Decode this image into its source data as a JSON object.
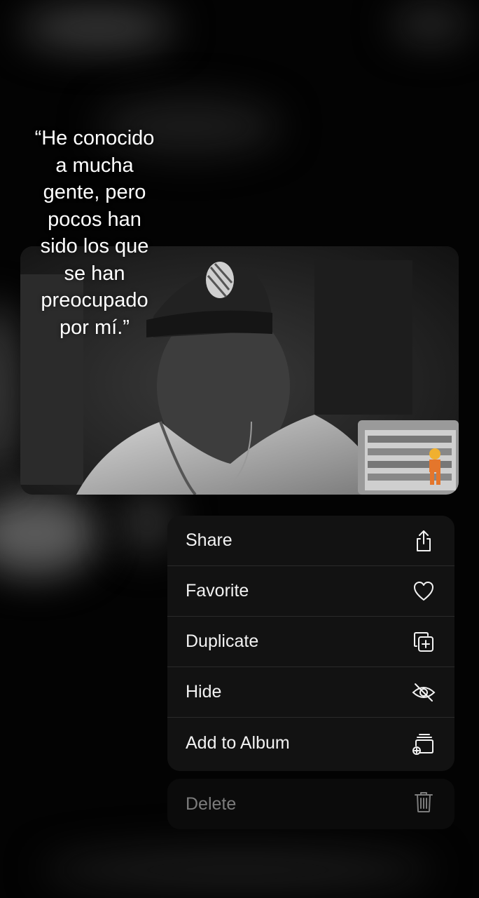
{
  "overlay": {
    "quote_text": "“He conocido a mucha gente, pero pocos han sido los que se han preocupado por mí.”"
  },
  "context_menu": {
    "items": [
      {
        "label": "Share",
        "icon": "share-icon"
      },
      {
        "label": "Favorite",
        "icon": "heart-icon"
      },
      {
        "label": "Duplicate",
        "icon": "duplicate-icon"
      },
      {
        "label": "Hide",
        "icon": "eye-slash-icon"
      },
      {
        "label": "Add to Album",
        "icon": "add-to-album-icon"
      }
    ],
    "delete": {
      "label": "Delete",
      "icon": "trash-icon"
    }
  },
  "colors": {
    "menu_background": "#121212",
    "menu_text": "#f2f2f2",
    "delete_text": "#7c7c7c",
    "page_background": "#030303"
  }
}
